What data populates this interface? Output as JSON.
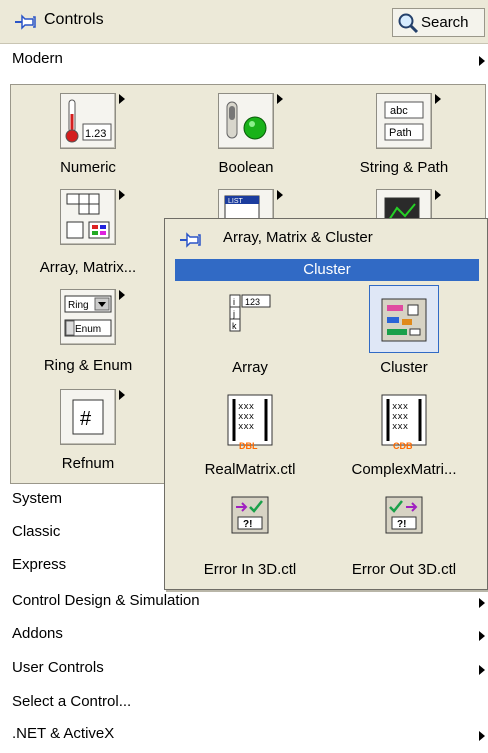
{
  "titlebar": {
    "title": "Controls",
    "search_label": "Search"
  },
  "menu_top": {
    "label": "Modern"
  },
  "palette": {
    "items": [
      {
        "label": "Numeric",
        "icon": "numeric-thermometer-icon"
      },
      {
        "label": "Boolean",
        "icon": "boolean-switch-led-icon"
      },
      {
        "label": "String & Path",
        "icon": "string-path-icon"
      },
      {
        "label": "Array, Matrix...",
        "icon": "array-matrix-icon"
      },
      {
        "label": "Ring & Enum",
        "icon": "ring-enum-icon"
      },
      {
        "label": "Refnum",
        "icon": "refnum-icon"
      }
    ]
  },
  "popup": {
    "title": "Array, Matrix & Cluster",
    "selected": "Cluster",
    "items": [
      {
        "label": "Array",
        "icon": "array-icon"
      },
      {
        "label": "Cluster",
        "icon": "cluster-icon"
      },
      {
        "label": "RealMatrix.ctl",
        "icon": "real-matrix-icon",
        "tag": "DBL"
      },
      {
        "label": "ComplexMatri...",
        "icon": "complex-matrix-icon",
        "tag": "CDB"
      },
      {
        "label": "Error In 3D.ctl",
        "icon": "error-in-icon",
        "tag": "?!"
      },
      {
        "label": "Error Out 3D.ctl",
        "icon": "error-out-icon",
        "tag": "?!"
      }
    ]
  },
  "menu_rows": [
    {
      "label": "System",
      "has_submenu": true
    },
    {
      "label": "Classic",
      "has_submenu": true
    },
    {
      "label": "Express",
      "has_submenu": true
    },
    {
      "label": "Control Design & Simulation",
      "has_submenu": true
    },
    {
      "label": "Addons",
      "has_submenu": true
    },
    {
      "label": "User Controls",
      "has_submenu": true
    },
    {
      "label": "Select a Control...",
      "has_submenu": false
    },
    {
      "label": ".NET & ActiveX",
      "has_submenu": true
    }
  ],
  "colors": {
    "selection": "#316ac5",
    "panel": "#ece9d8",
    "tag_orange": "#ff6a00"
  }
}
